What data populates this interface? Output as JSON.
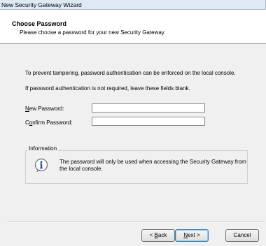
{
  "window": {
    "title": "New Security Gateway Wizard"
  },
  "header": {
    "title": "Choose Password",
    "subtitle": "Please choose a password for your new Security Gateway."
  },
  "body": {
    "paragraph1": "To prevent tampering, password authentication can be enforced on the local console.",
    "paragraph2": "If password authentication is not required, leave these fields blank."
  },
  "form": {
    "new_password": {
      "label_accel": "N",
      "label_rest": "ew Password:",
      "value": ""
    },
    "confirm_password": {
      "label_pre": "C",
      "label_accel": "o",
      "label_rest": "nfirm Password:",
      "value": ""
    }
  },
  "info": {
    "group_label": "Information",
    "icon": "info-icon",
    "text": "The password will only be used when accessing the Security Gateway from the local console."
  },
  "buttons": {
    "back": {
      "pre": "< ",
      "accel": "B",
      "rest": "ack"
    },
    "next": {
      "accel": "N",
      "rest": "ext >"
    },
    "cancel": "Cancel"
  }
}
